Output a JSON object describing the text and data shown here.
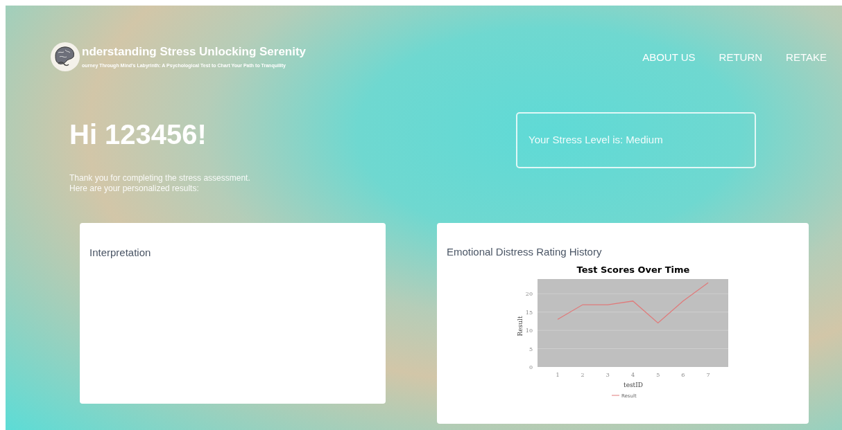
{
  "header": {
    "title": "nderstanding Stress Unlocking Serenity",
    "subtitle": "ourney Through Mind's Labyrinth: A Psychological Test to Chart Your Path to Tranquility"
  },
  "nav": [
    "ABOUT US",
    "RETURN",
    "RETAKE"
  ],
  "greeting": "Hi 123456!",
  "intro": [
    "Thank you for completing the stress assessment.",
    "Here are your personalized results:"
  ],
  "stress_level": "Your Stress Level is: Medium",
  "interpretation": {
    "title": "Interpretation"
  },
  "history": {
    "title": "Emotional Distress Rating History",
    "chart_data": {
      "type": "line",
      "title": "Test Scores Over Time",
      "xlabel": "testID",
      "ylabel": "Result",
      "x": [
        1,
        2,
        3,
        4,
        5,
        6,
        7
      ],
      "series": [
        {
          "name": "Result",
          "color": "#e07a7a",
          "values": [
            13,
            17,
            17,
            18,
            12,
            18,
            23
          ]
        }
      ],
      "xticks": [
        1,
        2,
        3,
        4,
        5,
        6,
        7
      ],
      "yticks": [
        0,
        5,
        10,
        15,
        20
      ],
      "xlim": [
        0.2,
        7.8
      ],
      "ylim": [
        0,
        24
      ],
      "grid": true
    }
  }
}
